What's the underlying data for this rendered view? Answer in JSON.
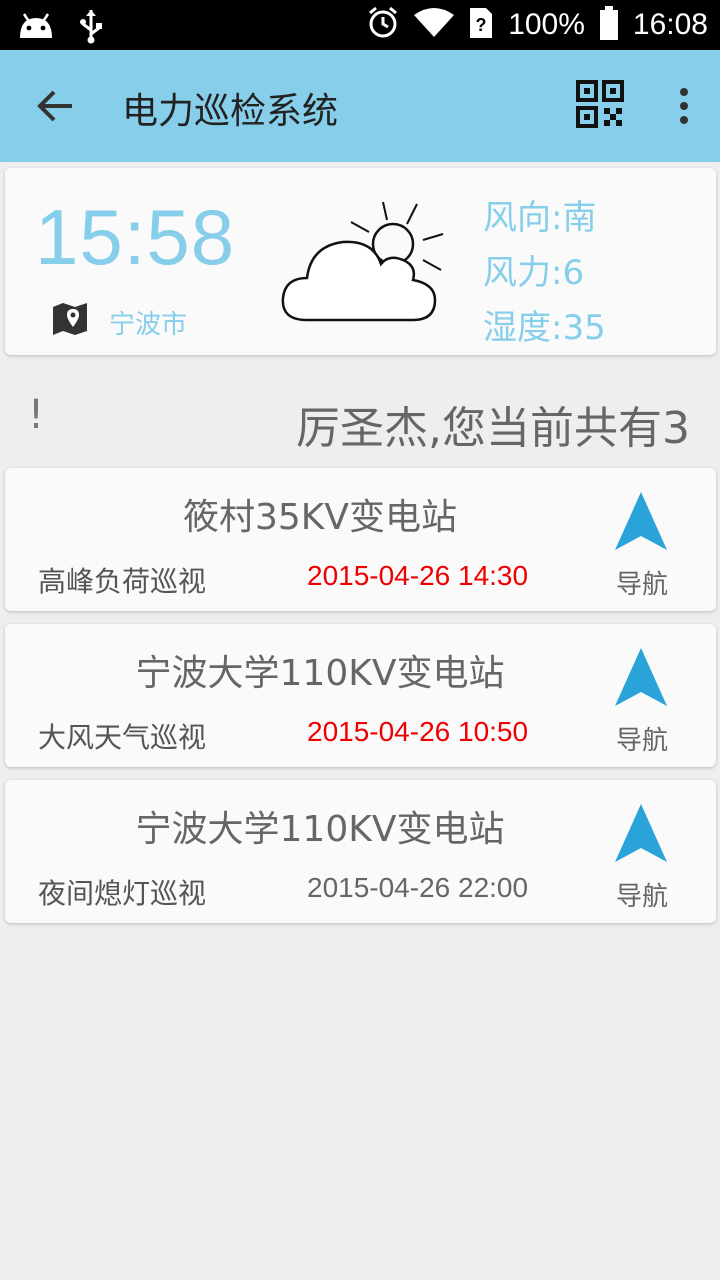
{
  "status_bar": {
    "battery_text": "100%",
    "clock": "16:08",
    "icons": [
      "android-icon",
      "usb-icon",
      "alarm-icon",
      "wifi-icon",
      "sim-question-icon",
      "battery-icon"
    ]
  },
  "app_bar": {
    "title": "电力巡检系统",
    "background_color": "#87ceeb",
    "icons": [
      "back-arrow-icon",
      "qr-code-icon",
      "overflow-menu-icon"
    ]
  },
  "weather": {
    "time": "15:58",
    "city": "宁波市",
    "wind_direction": "风向:南",
    "wind_force": "风力:6",
    "humidity": "湿度:35",
    "accent_color": "#87ceeb",
    "icons": [
      "map-location-icon",
      "partly-cloudy-icon"
    ]
  },
  "notice": {
    "mark": "!",
    "message": "厉圣杰,您当前共有3"
  },
  "tasks": [
    {
      "station": "筱村35KV变电站",
      "inspection": "高峰负荷巡视",
      "time": "2015-04-26 14:30",
      "time_color": "#ee0000",
      "nav_label": "导航"
    },
    {
      "station": "宁波大学110KV变电站",
      "inspection": "大风天气巡视",
      "time": "2015-04-26 10:50",
      "time_color": "#ee0000",
      "nav_label": "导航"
    },
    {
      "station": "宁波大学110KV变电站",
      "inspection": "夜间熄灯巡视",
      "time": "2015-04-26 22:00",
      "time_color": "#666666",
      "nav_label": "导航"
    }
  ]
}
